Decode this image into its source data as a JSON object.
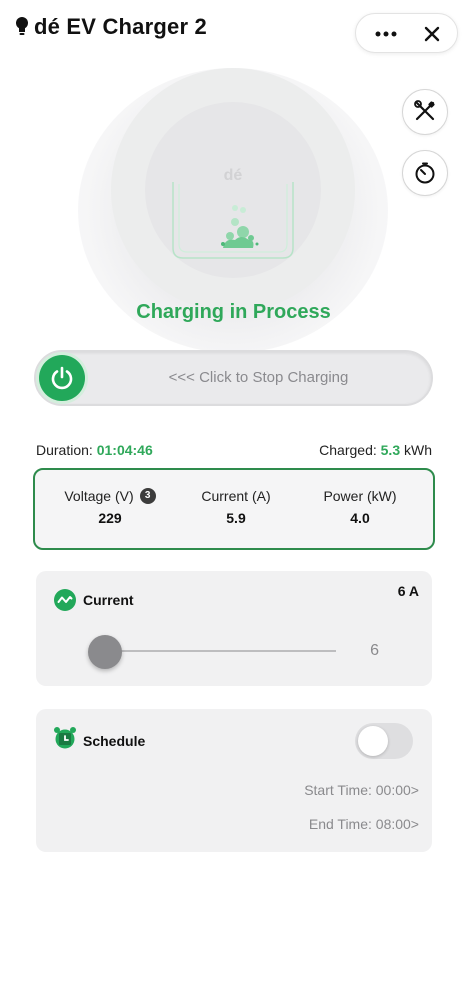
{
  "header": {
    "title": "dé EV Charger 2",
    "more_icon": "ellipsis-icon",
    "close_icon": "close-icon"
  },
  "hero": {
    "logo_text": "dé",
    "tools_icon": "wrench-screwdriver-icon",
    "timer_icon": "timer-icon"
  },
  "status": {
    "text": "Charging in Process",
    "color": "#2fa85a"
  },
  "stop_control": {
    "label": "<<< Click to Stop Charging",
    "icon": "power-icon",
    "color": "#22a85a"
  },
  "session": {
    "duration_label": "Duration:",
    "duration_value": "01:04:46",
    "charged_label": "Charged:",
    "charged_value": "5.3",
    "charged_unit": "kWh"
  },
  "metrics": [
    {
      "label": "Voltage (V)",
      "value": "229",
      "badge": "3"
    },
    {
      "label": "Current (A)",
      "value": "5.9"
    },
    {
      "label": "Power (kW)",
      "value": "4.0"
    }
  ],
  "current_setting": {
    "title": "Current",
    "readout": "6 A",
    "slider_value": "6",
    "slider_level": 0.0
  },
  "schedule": {
    "title": "Schedule",
    "enabled": false,
    "start_time": "Start Time: 00:00>",
    "end_time": "End Time: 08:00>"
  },
  "colors": {
    "accent": "#2fa85a",
    "border": "#2e8b4c"
  }
}
